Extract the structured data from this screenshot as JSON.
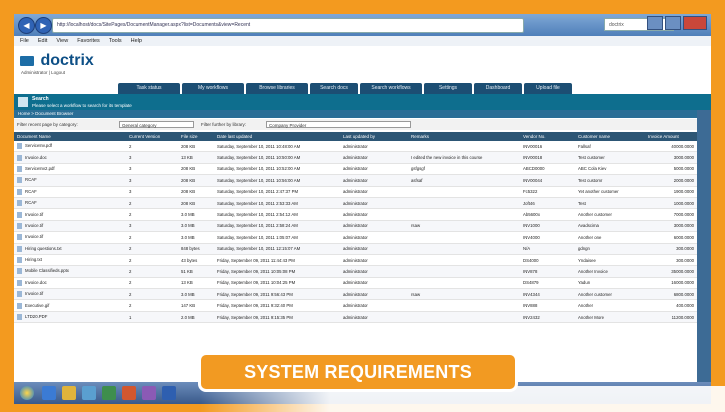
{
  "browser": {
    "search_placeholder": "doctrix",
    "menu": [
      "File",
      "Edit",
      "View",
      "Favorites",
      "Tools",
      "Help"
    ],
    "address_url": "http://localhost/docs/SitePages/DocumentManager.aspx?list=Documents&view=Recent"
  },
  "app": {
    "brand": "doctrix",
    "user_line": "Administrator | Logout",
    "tabs": [
      "Task status",
      "My workflows",
      "Browse libraries",
      "Search docs",
      "Search workflows",
      "Settings",
      "Dashboard",
      "Upload file"
    ],
    "section_title": "Search",
    "section_hint": "Please select a workflow to search for its template",
    "breadcrumb": "Home > Document Browser",
    "filter_label_1": "Filter recent page by category:",
    "filter_value_1": "General category",
    "filter_label_2": "Filter further by library:",
    "filter_value_2": "Company Provider"
  },
  "table": {
    "headers": [
      "Document Name",
      "Current Version",
      "File size",
      "Date last updated",
      "Last updated by",
      "Remarks",
      "Vendor No.",
      "Customer name",
      "Invoice Amount"
    ],
    "rows": [
      [
        "ServiceInv.pdf",
        "2",
        "208 KB",
        "Saturday, September 10, 2011 10:48:00 AM",
        "administrator",
        "",
        "INV00016",
        "Fallsaf",
        "40000.0000"
      ],
      [
        "Invoice.doc",
        "3",
        "13 KB",
        "Saturday, September 10, 2011 10:50:00 AM",
        "administrator",
        "I edited the new invoice in this course",
        "INV00018",
        "Test customer",
        "3000.0000"
      ],
      [
        "ServiceInv2.pdf",
        "3",
        "208 KB",
        "Saturday, September 10, 2011 10:52:00 AM",
        "administrator",
        "gsfgsgf",
        "ABCD0000",
        "ABC Cola Kiev",
        "5000.0000"
      ],
      [
        "RCAF",
        "3",
        "208 KB",
        "Saturday, September 10, 2011 10:56:00 AM",
        "administrator",
        "asfsaf",
        "INV00044",
        "Test customr",
        "2000.0000"
      ],
      [
        "RCAF",
        "3",
        "208 KB",
        "Saturday, September 10, 2011 2:47:37 PM",
        "administrator",
        "",
        "Fc5322",
        "Yet another customer",
        "1900.0000"
      ],
      [
        "RCAF",
        "2",
        "208 KB",
        "Saturday, September 10, 2011 2:53:33 AM",
        "administrator",
        "",
        "Joft46",
        "Test",
        "1000.0000"
      ],
      [
        "Invoice.tif",
        "2",
        "3.0 MB",
        "Saturday, September 10, 2011 2:54:12 AM",
        "administrator",
        "",
        "Ab5600x",
        "Another customer",
        "7000.0000"
      ],
      [
        "Invoice.tif",
        "3",
        "3.0 MB",
        "Saturday, September 10, 2011 2:58:24 AM",
        "administrator",
        "rsaw",
        "INV1000",
        "Avadscima",
        "3000.0000"
      ],
      [
        "Invoice.tif",
        "2",
        "3.0 MB",
        "Saturday, September 10, 2011 1:05:07 AM",
        "administrator",
        "",
        "INV4000",
        "Another one",
        "6000.0000"
      ],
      [
        "Hiring questions.txt",
        "2",
        "848 bytes",
        "Saturday, September 10, 2011 12:15:07 AM",
        "administrator",
        "",
        "N/A",
        "gdngn",
        "300.0000"
      ],
      [
        "Hiring.txt",
        "2",
        "43 bytes",
        "Friday, September 09, 2011 11:44:43 PM",
        "administrator",
        "",
        "DS4000",
        "Yndaisee",
        "300.0000"
      ],
      [
        "Mobile Classifieds.pptx",
        "2",
        "51 KB",
        "Friday, September 09, 2011 10:05:08 PM",
        "administrator",
        "",
        "INV878",
        "Another Invoice",
        "35000.0000"
      ],
      [
        "Invoice.doc",
        "2",
        "13 KB",
        "Friday, September 09, 2011 10:04:25 PM",
        "administrator",
        "",
        "DS4879",
        "Yadun",
        "16000.0000"
      ],
      [
        "Invoice.tif",
        "2",
        "3.0 MB",
        "Friday, September 09, 2011 9:56:43 PM",
        "administrator",
        "rsaw",
        "INV4344",
        "Another customer",
        "6800.0000"
      ],
      [
        "Executive.gif",
        "2",
        "147 KB",
        "Friday, September 09, 2011 9:32:40 PM",
        "administrator",
        "",
        "INV888",
        "Another",
        "400.0000"
      ],
      [
        "LTD20.PDF",
        "1",
        "2.0 MB",
        "Friday, September 09, 2011 9:15:35 PM",
        "administrator",
        "",
        "INV2432",
        "Another More",
        "11200.0000"
      ]
    ]
  },
  "overlay": {
    "button_label": "SYSTEM REQUIREMENTS"
  },
  "colors": {
    "page_background": "#f39a1f",
    "accent": "#0e6e8e"
  }
}
